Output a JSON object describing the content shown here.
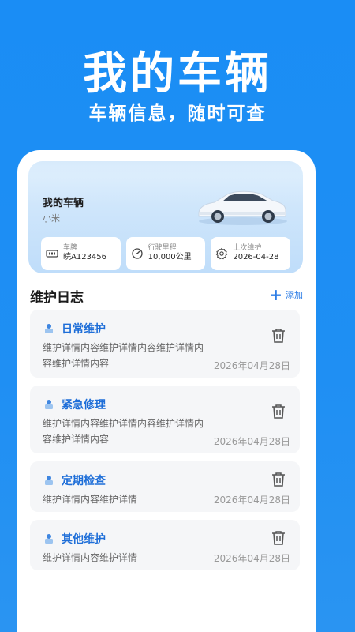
{
  "hero": {
    "title": "我的车辆",
    "subtitle": "车辆信息，随时可查"
  },
  "vehicle": {
    "title": "我的车辆",
    "brand": "小米",
    "plate_label": "车牌",
    "plate_value": "皖A123456",
    "mileage_label": "行驶里程",
    "mileage_value": "10,000公里",
    "last_service_label": "上次维护",
    "last_service_value": "2026-04-28"
  },
  "logs": {
    "title": "维护日志",
    "add_label": "添加",
    "items": [
      {
        "name": "日常维护",
        "detail": "维护详情内容维护详情内容维护详情内容维护详情内容",
        "date": "2026年04月28日"
      },
      {
        "name": "紧急修理",
        "detail": "维护详情内容维护详情内容维护详情内容维护详情内容",
        "date": "2026年04月28日"
      },
      {
        "name": "定期检查",
        "detail": "维护详情内容维护详情",
        "date": "2026年04月28日"
      },
      {
        "name": "其他维护",
        "detail": "维护详情内容维护详情",
        "date": "2026年04月28日"
      }
    ]
  },
  "colors": {
    "brand_blue": "#1a8df5",
    "accent_text": "#1e6ed8",
    "card_bg": "#f5f6f8"
  },
  "icons": [
    "plate-icon",
    "speedometer-icon",
    "settings-icon",
    "plus-icon",
    "trash-icon",
    "maintenance-icon"
  ]
}
